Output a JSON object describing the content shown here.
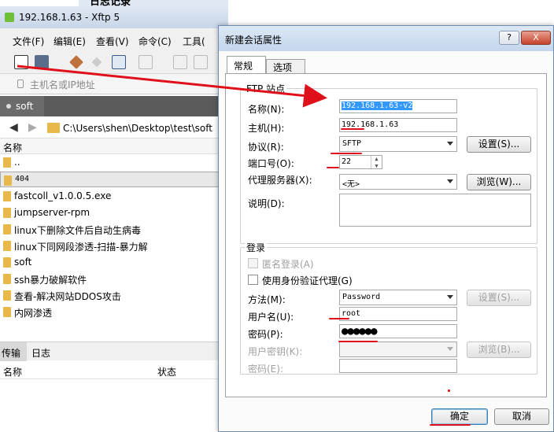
{
  "main": {
    "title": "192.168.1.63 - Xftp 5",
    "menu": [
      "文件(F)",
      "编辑(E)",
      "查看(V)",
      "命令(C)",
      "工具("
    ],
    "address_placeholder": "主机名或IP地址",
    "session_tab": "soft",
    "path": "C:\\Users\\shen\\Desktop\\test\\soft",
    "col_name": "名称",
    "files": [
      {
        "name": ".."
      },
      {
        "name": "404"
      },
      {
        "name": "fastcoll_v1.0.0.5.exe"
      },
      {
        "name": "jumpserver-rpm"
      },
      {
        "name": "linux下删除文件后自动生病毒"
      },
      {
        "name": "linux下同网段渗透-扫描-暴力解"
      },
      {
        "name": "soft"
      },
      {
        "name": "ssh暴力破解软件"
      },
      {
        "name": "查看-解决网站DDOS攻击"
      },
      {
        "name": "内网渗透"
      }
    ],
    "bottom_tabs": [
      "传输",
      "日志"
    ],
    "bottom_cols": [
      "名称",
      "状态"
    ],
    "top_fragment": "日志记录"
  },
  "dialog": {
    "title": "新建会话属性",
    "help": "?",
    "close": "X",
    "tabs": [
      "常规",
      "选项"
    ],
    "ftp_site_label": "FTP 站点",
    "name_label": "名称(N):",
    "name_value": "192.168.1.63-v2",
    "host_label": "主机(H):",
    "host_value": "192.168.1.63",
    "protocol_label": "协议(R):",
    "protocol_value": "SFTP",
    "settings_btn": "设置(S)...",
    "port_label": "端口号(O):",
    "port_value": "22",
    "proxy_label": "代理服务器(X):",
    "proxy_value": "<无>",
    "browse_btn": "浏览(W)...",
    "desc_label": "说明(D):",
    "desc_value": "",
    "login_label": "登录",
    "anon_label": "匿名登录(A)",
    "auth_agent_label": "使用身份验证代理(G)",
    "method_label": "方法(M):",
    "method_value": "Password",
    "method_settings_btn": "设置(S)...",
    "user_label": "用户名(U):",
    "user_value": "root",
    "pass_label": "密码(P):",
    "pass_value": "●●●●●●",
    "userkey_label": "用户密钥(K):",
    "userkey_browse_btn": "浏览(B)...",
    "passphrase_label": "密码(E):",
    "ok": "确定",
    "cancel": "取消"
  },
  "colors": {
    "annotation": "#e0101a",
    "selection": "#3399ff"
  }
}
